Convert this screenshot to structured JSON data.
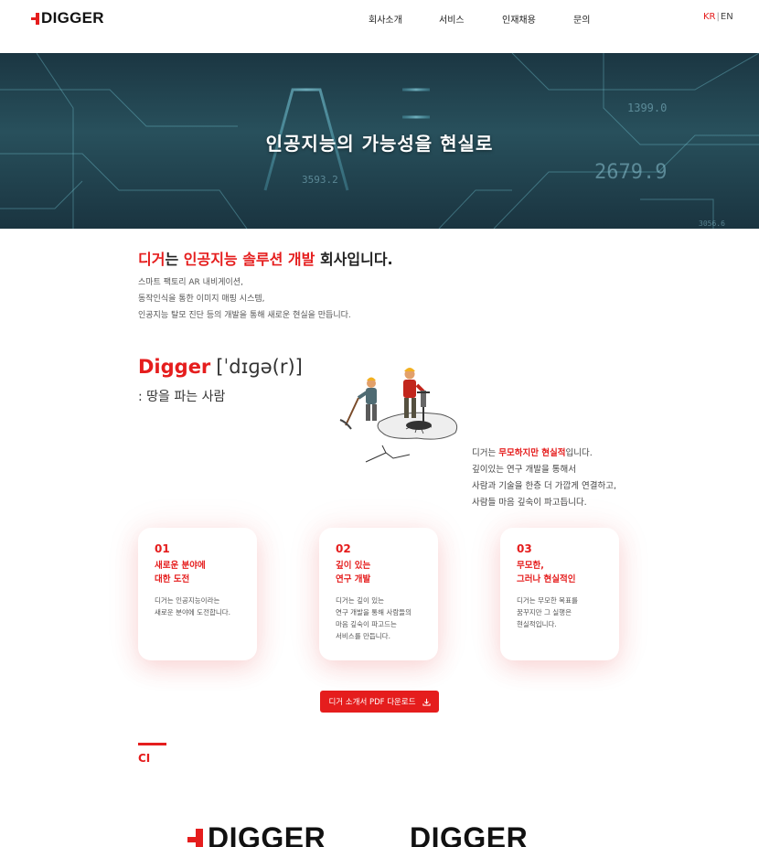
{
  "header": {
    "logo": "DIGGER",
    "nav": [
      "회사소개",
      "서비스",
      "인재채용",
      "문의"
    ],
    "lang": {
      "kr": "KR",
      "separator": "|",
      "en": "EN"
    }
  },
  "hero": {
    "title": "인공지능의 가능성을 현실로",
    "background_text": [
      "AI",
      "1399.0",
      "3593.2",
      "2679.9",
      "3056.6"
    ]
  },
  "intro": {
    "heading_parts": [
      "디거",
      "는 ",
      "인공지능 솔루션 개발",
      " 회사입니다."
    ],
    "lines": [
      "스마트 팩토리 AR 내비게이션,",
      "동작인식을 통한 이미지 매핑 시스템,",
      "인공지능 탈모 진단 등의 개발을 통해 새로운 현실을 만듭니다."
    ]
  },
  "definition": {
    "word": "Digger",
    "phonetic": "[ˈdɪɡə(r)]",
    "meaning": ": 땅을 파는 사람"
  },
  "philosophy": {
    "line1_parts": [
      "디거는 ",
      "무모하지만 현실적",
      "입니다."
    ],
    "lines": [
      "깊이있는 연구 개발을 통해서",
      "사람과 기술을 한층 더 가깝게 연결하고,",
      "사람들 마음 깊숙이 파고듭니다."
    ]
  },
  "cards": [
    {
      "num": "01",
      "title": [
        "새로운 분야에",
        "대한 도전"
      ],
      "body": [
        "디거는 인공지능이라는",
        "새로운 분야에 도전합니다."
      ]
    },
    {
      "num": "02",
      "title": [
        "깊이 있는",
        "연구 개발"
      ],
      "body": [
        "디거는 깊이 있는",
        "연구 개발을 통해 사람들의",
        "마음 깊숙이 파고드는",
        "서비스를 만듭니다."
      ]
    },
    {
      "num": "03",
      "title": [
        "무모한,",
        "그러나 현실적인"
      ],
      "body": [
        "디거는 무모한 목표를",
        "꿈꾸지만 그 실행은",
        "현실적입니다."
      ]
    }
  ],
  "download_button": {
    "label": "디거 소개서 PDF 다운로드",
    "icon": "download-icon"
  },
  "ci": {
    "title": "CI",
    "logo_color": "DIGGER",
    "logo_mono": "DIGGER"
  },
  "colors": {
    "accent": "#e51d1d",
    "hero_bg": "#1f3d48",
    "text": "#222222"
  }
}
